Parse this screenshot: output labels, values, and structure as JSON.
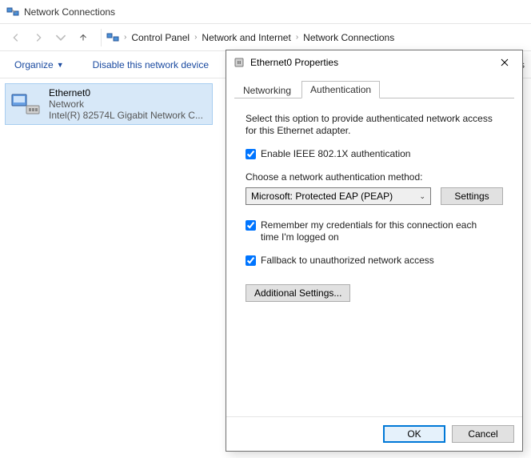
{
  "window": {
    "title": "Network Connections"
  },
  "breadcrumb": {
    "items": [
      "Control Panel",
      "Network and Internet",
      "Network Connections"
    ]
  },
  "toolbar": {
    "organize": "Organize",
    "disable": "Disable this network device",
    "right_clip": "us"
  },
  "connection": {
    "name": "Ethernet0",
    "status": "Network",
    "device": "Intel(R) 82574L Gigabit Network C..."
  },
  "dialog": {
    "title": "Ethernet0 Properties",
    "tabs": {
      "networking": "Networking",
      "authentication": "Authentication"
    },
    "pane": {
      "description": "Select this option to provide authenticated network access for this Ethernet adapter.",
      "enable_8021x": "Enable IEEE 802.1X authentication",
      "method_label": "Choose a network authentication method:",
      "method_value": "Microsoft: Protected EAP (PEAP)",
      "settings_btn": "Settings",
      "remember": "Remember my credentials for this connection each time I'm logged on",
      "fallback": "Fallback to unauthorized network access",
      "additional": "Additional Settings..."
    },
    "footer": {
      "ok": "OK",
      "cancel": "Cancel"
    }
  }
}
